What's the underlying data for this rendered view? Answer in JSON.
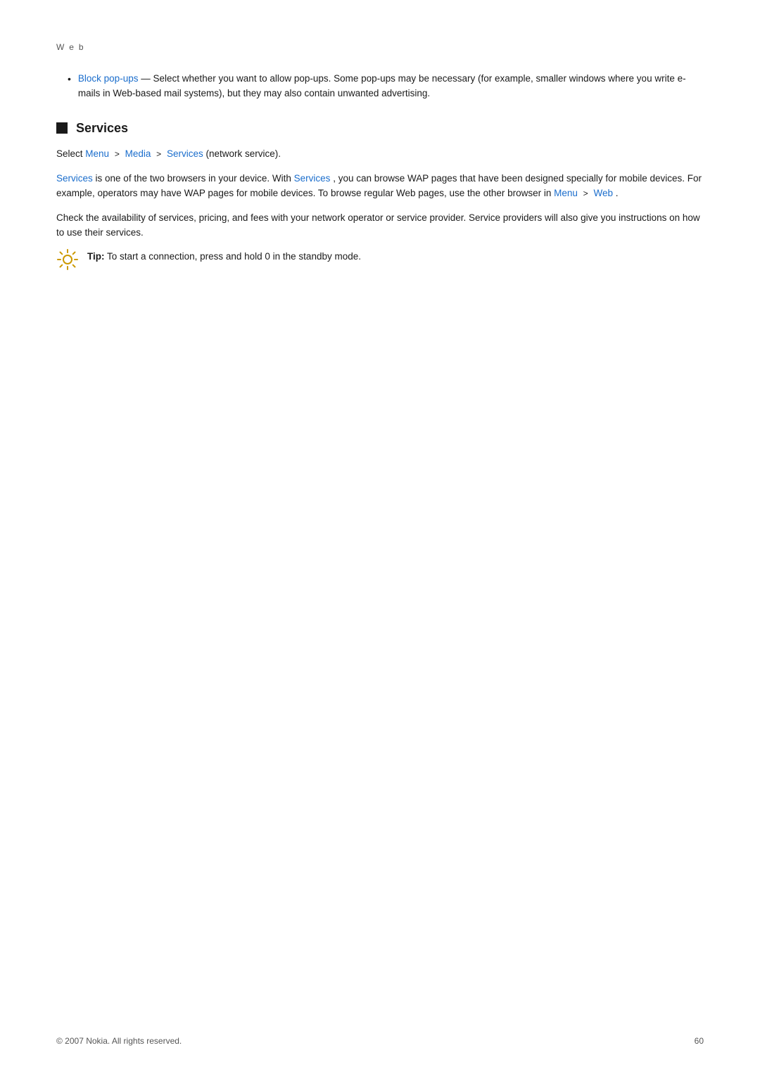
{
  "page": {
    "header": "W e b",
    "footer_left": "© 2007 Nokia. All rights reserved.",
    "footer_right": "60"
  },
  "bullet_section": {
    "items": [
      {
        "link_text": "Block pop-ups",
        "rest_text": " — Select whether you want to allow pop-ups. Some pop-ups may be necessary (for example, smaller windows where you write e-mails in Web-based mail systems), but they may also contain unwanted advertising."
      }
    ]
  },
  "services_section": {
    "heading": "Services",
    "nav_line": {
      "select_text": "Select ",
      "menu_text": "Menu",
      "arrow1": ">",
      "media_text": "Media",
      "arrow2": ">",
      "services_text": "Services",
      "suffix": " (network service)."
    },
    "paragraph1_before": "",
    "paragraph1": {
      "services_link1": "Services",
      "text1": " is one of the two browsers in your device. With ",
      "services_link2": "Services",
      "text2": ", you can browse WAP pages that have been designed specially for mobile devices. For example, operators may have WAP pages for mobile devices. To browse regular Web pages, use the other browser in ",
      "menu_link": "Menu",
      "arrow": ">",
      "web_link": "Web",
      "text3": "."
    },
    "paragraph2": "Check the availability of services, pricing, and fees with your network operator or service provider. Service providers will also give you instructions on how to use their services.",
    "tip": {
      "bold": "Tip:",
      "text": " To start a connection, press and hold 0 in the standby mode."
    }
  }
}
